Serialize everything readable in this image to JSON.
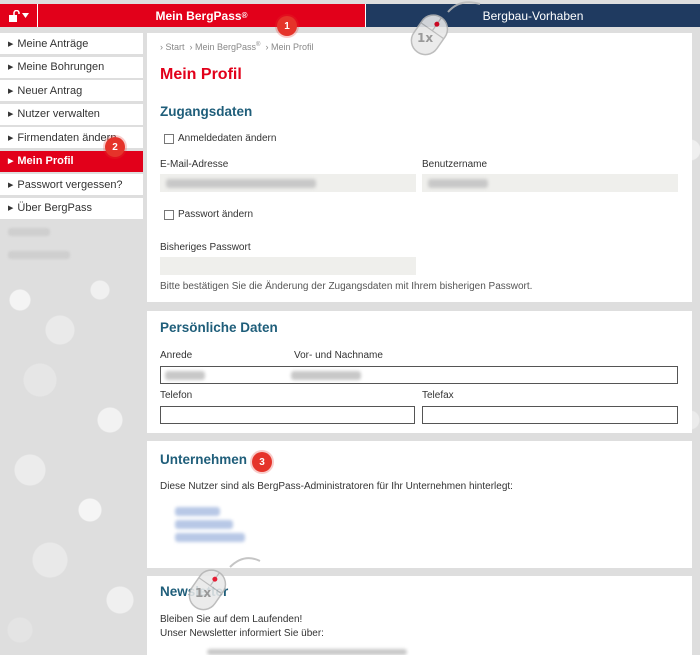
{
  "topbar": {
    "lock_icon": "lock-open-icon",
    "tab_bergpass": "Mein BergPass",
    "tab_bergpass_sup": "®",
    "tab_bergbau": "Bergbau-Vorhaben"
  },
  "sidebar": {
    "items": [
      {
        "label": "Meine Anträge"
      },
      {
        "label": "Meine Bohrungen"
      },
      {
        "label": "Neuer Antrag"
      },
      {
        "label": "Nutzer verwalten"
      },
      {
        "label": "Firmendaten ändern"
      },
      {
        "label": "Mein Profil"
      },
      {
        "label": "Passwort vergessen?"
      },
      {
        "label": "Über BergPass"
      }
    ]
  },
  "breadcrumb": {
    "start": "Start",
    "bergpass": "Mein BergPass",
    "bergpass_sup": "®",
    "profil": "Mein Profil"
  },
  "page_title": "Mein Profil",
  "zugangsdaten": {
    "heading": "Zugangsdaten",
    "change_login_label": "Anmeldedaten ändern",
    "email_label": "E-Mail-Adresse",
    "username_label": "Benutzername",
    "change_password_label": "Passwort ändern",
    "old_password_label": "Bisheriges Passwort",
    "hint": "Bitte bestätigen Sie die Änderung der Zugangsdaten mit Ihrem bisherigen Passwort."
  },
  "persoenlich": {
    "heading": "Persönliche Daten",
    "anrede_label": "Anrede",
    "name_label": "Vor- und Nachname",
    "telefon_label": "Telefon",
    "telefax_label": "Telefax"
  },
  "unternehmen": {
    "heading": "Unternehmen",
    "text": "Diese Nutzer sind als BergPass-Administratoren für Ihr Unternehmen hinterlegt:"
  },
  "newsletter": {
    "heading": "Newsletter",
    "line1": "Bleiben Sie auf dem Laufenden!",
    "line2": "Unser Newsletter informiert Sie über:"
  },
  "annotations": {
    "badge1": "1",
    "badge2": "2",
    "badge3": "3",
    "mouse_click": "1x"
  }
}
